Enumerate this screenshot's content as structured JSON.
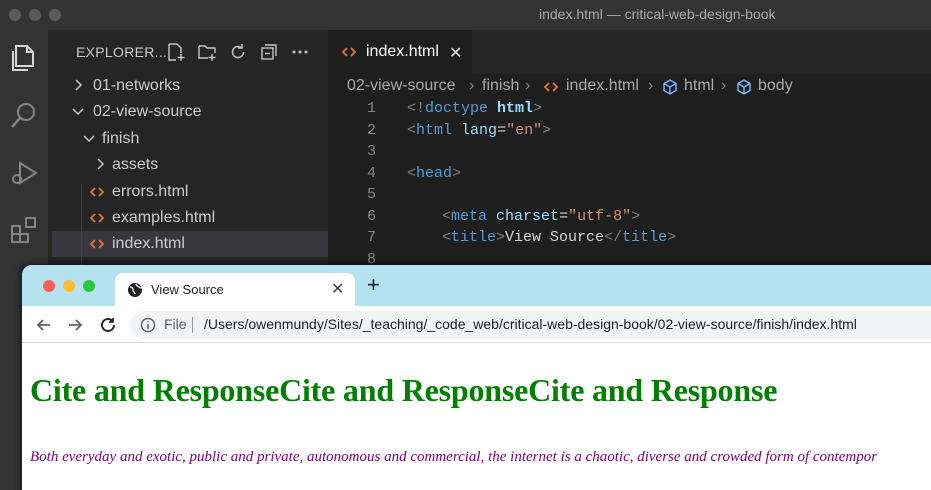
{
  "vscode": {
    "title": "index.html — critical-web-design-book",
    "explorer": {
      "title": "EXPLORER...",
      "tree": [
        {
          "label": "01-networks",
          "kind": "folder",
          "expanded": false
        },
        {
          "label": "02-view-source",
          "kind": "folder",
          "expanded": true
        },
        {
          "label": "finish",
          "kind": "folder",
          "expanded": true
        },
        {
          "label": "assets",
          "kind": "folder",
          "expanded": false
        },
        {
          "label": "errors.html",
          "kind": "html-file"
        },
        {
          "label": "examples.html",
          "kind": "html-file"
        },
        {
          "label": "index.html",
          "kind": "html-file",
          "selected": true
        }
      ]
    },
    "tab": {
      "label": "index.html"
    },
    "breadcrumb": [
      "02-view-source",
      "finish",
      "index.html",
      "html",
      "body"
    ],
    "code": {
      "line_numbers": [
        "1",
        "2",
        "3",
        "4",
        "5",
        "6",
        "7",
        "8"
      ],
      "line1": {
        "open": "<!",
        "kw": "doctype",
        "sp": " ",
        "tag": "html",
        "close": ">"
      },
      "line2": {
        "open": "<",
        "tag": "html",
        "sp": " ",
        "attr": "lang",
        "eq": "=",
        "val": "\"en\"",
        "close": ">"
      },
      "line4": {
        "open": "<",
        "tag": "head",
        "close": ">"
      },
      "line6": {
        "open": "<",
        "tag": "meta",
        "sp": " ",
        "attr": "charset",
        "eq": "=",
        "val": "\"utf-8\"",
        "close": ">"
      },
      "line7": {
        "open": "<",
        "tag": "title",
        "close": ">",
        "text": "View Source",
        "open2": "</",
        "tag2": "title",
        "close2": ">"
      }
    },
    "colors": {
      "tag": "#569cd6",
      "attr": "#9cdcfe",
      "string": "#ce9178",
      "punct": "#808080",
      "html_icon": "#e37933"
    }
  },
  "chrome": {
    "tab_title": "View Source",
    "address": {
      "scheme_label": "File",
      "url": "/Users/owenmundy/Sites/_teaching/_code_web/critical-web-design-book/02-view-source/finish/index.html"
    },
    "page": {
      "heading": "Cite and ResponseCite and ResponseCite and Response",
      "paragraph": "Both everyday and exotic, public and private, autonomous and commercial, the internet is a chaotic, diverse and crowded form of contempor"
    },
    "colors": {
      "tabstrip": "#b4e3ef",
      "heading": "#008000",
      "paragraph": "#800080"
    }
  }
}
